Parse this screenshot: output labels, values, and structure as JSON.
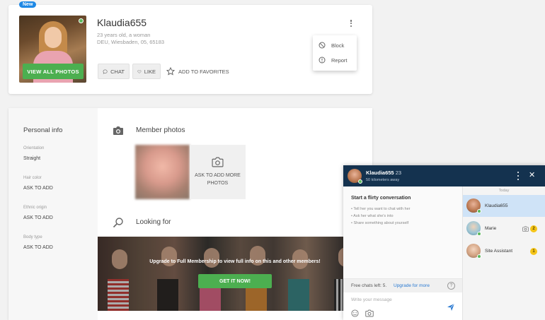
{
  "profile": {
    "new_badge": "New",
    "username": "Klaudia655",
    "age_line": "23 years old, a woman",
    "location_line": "DEU, Wiesbaden, 05, 65183",
    "view_photos_label": "VIEW ALL PHOTOS",
    "chat_label": "CHAT",
    "like_label": "LIKE",
    "favorites_label": "ADD TO FAVORITES"
  },
  "menu": {
    "block_label": "Block",
    "report_label": "Report"
  },
  "personal_info": {
    "title": "Personal info",
    "fields": [
      {
        "label": "Orientation",
        "value": "Straight"
      },
      {
        "label": "Hair color",
        "value": "ASK TO ADD"
      },
      {
        "label": "Ethnic origin",
        "value": "ASK TO ADD"
      },
      {
        "label": "Body type",
        "value": "ASK TO ADD"
      }
    ]
  },
  "photos": {
    "title": "Member photos",
    "ask_more_label": "ASK TO ADD MORE PHOTOS"
  },
  "looking_for": {
    "title": "Looking for",
    "promo_text": "Upgrade to Full Membership to view full info on this and other members!",
    "promo_button": "GET IT NOW!"
  },
  "chat": {
    "name": "Klaudia655",
    "age": "23",
    "distance": "50 kilometers away",
    "flirty_title": "Start a flirty conversation",
    "tips": [
      "Tell her you want to chat with her",
      "Ask her what she's into",
      "Share something about yourself"
    ],
    "free_chats": "Free chats left: 5.",
    "upgrade_link": "Upgrade for more",
    "input_placeholder": "Write your message",
    "today_label": "Today",
    "conversations": [
      {
        "name": "Klaudia655",
        "badge": ""
      },
      {
        "name": "Marie",
        "badge": "2"
      },
      {
        "name": "Site Assistant",
        "badge": "1"
      }
    ]
  },
  "colors": {
    "accent_green": "#4caf50",
    "chat_header": "#14324f",
    "link_blue": "#2979d1",
    "badge_blue": "#1e88e5"
  }
}
